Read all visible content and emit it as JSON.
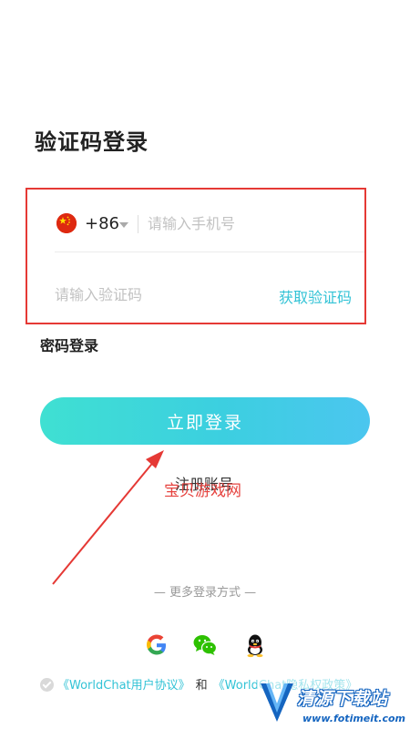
{
  "page": {
    "title": "验证码登录"
  },
  "form": {
    "country_code": "+86",
    "phone_placeholder": "请输入手机号",
    "code_placeholder": "请输入验证码",
    "get_code_label": "获取验证码"
  },
  "password_login_label": "密码登录",
  "login_button_label": "立即登录",
  "register_label": "注册账号",
  "watermark": {
    "overlay_text": "宝贝游戏网",
    "site_name": "清源下载站",
    "site_url": "www.fotimeit.com"
  },
  "more_login_label": "— 更多登录方式 —",
  "social": [
    {
      "name": "google",
      "icon": "google-icon"
    },
    {
      "name": "wechat",
      "icon": "wechat-icon"
    },
    {
      "name": "qq",
      "icon": "qq-icon"
    }
  ],
  "agreement": {
    "user_agreement": "《WorldChat用户协议》",
    "and": "和",
    "privacy_policy": "《WorldChat隐私权政策》"
  },
  "colors": {
    "accent": "#33c3d6",
    "button_gradient_start": "#3fe0d2",
    "button_gradient_end": "#4bc6ef",
    "annotation_red": "#e53935"
  }
}
